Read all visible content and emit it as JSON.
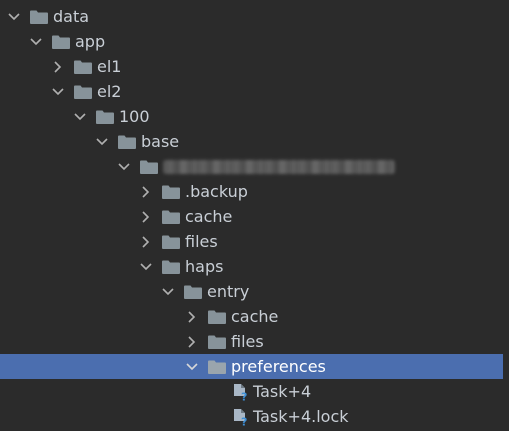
{
  "tree": {
    "rows": [
      {
        "label": "data",
        "expanded": true,
        "icon": "folder-icon"
      },
      {
        "label": "app",
        "expanded": true,
        "icon": "folder-icon"
      },
      {
        "label": "el1",
        "expanded": false,
        "icon": "folder-icon"
      },
      {
        "label": "el2",
        "expanded": true,
        "icon": "folder-icon"
      },
      {
        "label": "100",
        "expanded": true,
        "icon": "folder-icon"
      },
      {
        "label": "base",
        "expanded": true,
        "icon": "folder-icon"
      },
      {
        "label": "",
        "expanded": true,
        "icon": "folder-icon",
        "redacted": true
      },
      {
        "label": ".backup",
        "expanded": false,
        "icon": "folder-icon"
      },
      {
        "label": "cache",
        "expanded": false,
        "icon": "folder-icon"
      },
      {
        "label": "files",
        "expanded": false,
        "icon": "folder-icon"
      },
      {
        "label": "haps",
        "expanded": true,
        "icon": "folder-icon"
      },
      {
        "label": "entry",
        "expanded": true,
        "icon": "folder-icon"
      },
      {
        "label": "cache",
        "expanded": false,
        "icon": "folder-icon"
      },
      {
        "label": "files",
        "expanded": false,
        "icon": "folder-icon"
      },
      {
        "label": "preferences",
        "expanded": true,
        "icon": "folder-icon",
        "selected": true
      },
      {
        "label": "Task+4",
        "icon": "unknown-file-icon"
      },
      {
        "label": "Task+4.lock",
        "icon": "unknown-file-icon"
      }
    ]
  },
  "colors": {
    "background": "#2b2b2b",
    "selection": "#4b6eaf",
    "folder": "#87939a",
    "text": "#c9cfd6",
    "unknown_badge": "#3d8fd6"
  }
}
